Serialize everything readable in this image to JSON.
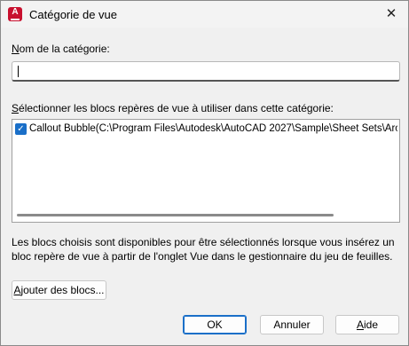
{
  "window": {
    "title": "Catégorie de vue",
    "app_icon_letter": "A",
    "close_glyph": "✕"
  },
  "form": {
    "name_label_underlined": "N",
    "name_label_rest": "om de la catégorie:",
    "name_value": "",
    "blocks_label_underlined": "S",
    "blocks_label_rest": "électionner les blocs repères de vue à utiliser dans cette catégorie:",
    "blocks": [
      {
        "checked": true,
        "label": "Callout Bubble(C:\\Program Files\\Autodesk\\AutoCAD 2027\\Sample\\Sheet Sets\\Architectural"
      }
    ],
    "info_text": "Les blocs choisis sont disponibles pour être sélectionnés lorsque vous insérez un bloc repère de vue à partir de l'onglet Vue dans le gestionnaire du jeu de feuilles."
  },
  "buttons": {
    "add_blocks_underlined": "A",
    "add_blocks_rest": "jouter des blocs...",
    "ok": "OK",
    "cancel": "Annuler",
    "help_underlined": "A",
    "help_rest": "ide"
  },
  "colors": {
    "accent": "#1a6fc8",
    "app_icon": "#c8102e",
    "background": "#f0f0f0"
  },
  "icons": {
    "app": "autocad-app-icon",
    "close": "close-icon",
    "check": "checkmark-icon"
  }
}
